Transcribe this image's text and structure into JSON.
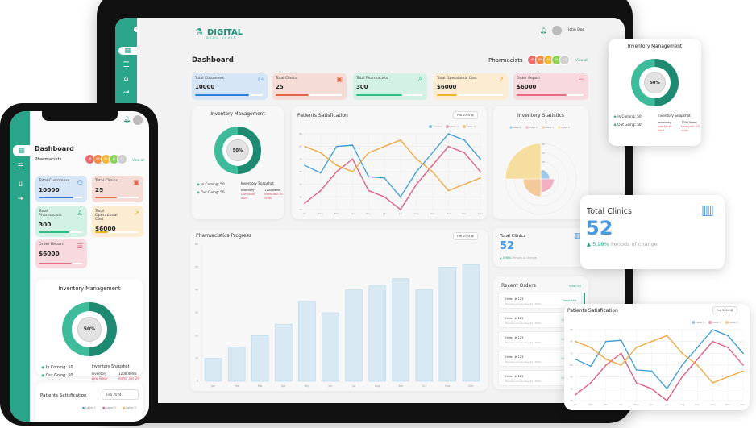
{
  "app": {
    "logo_main": "DIGITAL",
    "logo_sub": "DRUG VAULT",
    "user_name": "John Doe"
  },
  "colors": {
    "accent": "#2aa58a",
    "blue": "#3a9ad9",
    "pink": "#e0567f",
    "orange": "#f0a53a"
  },
  "dashboard": {
    "title": "Dashboard",
    "pharmacists_label": "Pharmacists",
    "pharmacist_avatars": [
      {
        "initials": "JD",
        "color": "#ea6b6b"
      },
      {
        "initials": "AM",
        "color": "#f08a4b"
      },
      {
        "initials": "AK",
        "color": "#f3b73b"
      },
      {
        "initials": "JA",
        "color": "#8bd35a"
      },
      {
        "initials": "+2",
        "color": "#cfcfcf"
      }
    ],
    "view_all": "View all",
    "stats": [
      {
        "label": "Total Customers",
        "value": "10000",
        "icon": "users-icon",
        "glyph": "⚇",
        "bg": "#d6e6f7",
        "color": "#2f7fd8",
        "progress": 0.8
      },
      {
        "label": "Total Clinics",
        "value": "25",
        "icon": "clinic-icon",
        "glyph": "▣",
        "bg": "#f6dcd6",
        "color": "#e0674a",
        "progress": 0.5
      },
      {
        "label": "Total Pharmacists",
        "value": "300",
        "icon": "user-icon",
        "glyph": "♙",
        "bg": "#d4f1e6",
        "color": "#2dbd85",
        "progress": 0.7
      },
      {
        "label": "Total Operational Cost",
        "value": "$6000",
        "icon": "trend-chart-icon",
        "glyph": "↗",
        "bg": "#fbecd2",
        "color": "#f0b429",
        "progress": 0.3
      },
      {
        "label": "Order Report",
        "value": "$6000",
        "icon": "list-icon",
        "glyph": "☰",
        "bg": "#f8d9df",
        "color": "#e86a83",
        "progress": 0.75
      }
    ]
  },
  "inventory": {
    "title": "Inventory Management",
    "percent": "50%",
    "incoming": "In Coming: 50",
    "outgoing": "Out Going: 50",
    "snapshot_title": "Inventory Snapshot",
    "snapshot_rows": [
      [
        "Inventory",
        "1200 Items"
      ],
      [
        "Low Stock Alert",
        "Items abc 20 units"
      ]
    ]
  },
  "date_filter": {
    "label": "Date",
    "value": "Feb 2024"
  },
  "patients_title": "Patients Satisfication",
  "progress_title": "Pharmacistics Progress",
  "inventory_stats_title": "Inventory Statistics",
  "total_clinics": {
    "title": "Total Clinics",
    "value": "52",
    "change": "5.98%",
    "change_label": "Periods of change"
  },
  "recent_orders": {
    "title": "Recent Orders",
    "view_all": "View all",
    "items": [
      {
        "order": "Order # 123",
        "delivery": "Delivery on January 21, 2024",
        "status": "Completed"
      },
      {
        "order": "Order # 123",
        "delivery": "Delivery on January 21, 2024",
        "status": "Completed"
      },
      {
        "order": "Order # 123",
        "delivery": "Delivery on January 21, 2024",
        "status": "Completed"
      },
      {
        "order": "Order # 123",
        "delivery": "Delivery on January 21, 2024",
        "status": "Completed"
      },
      {
        "order": "Order # 123",
        "delivery": "Delivery on January 21, 2024",
        "status": "Completed"
      }
    ]
  },
  "chart_data": [
    {
      "type": "line",
      "title": "Patients Satisfication",
      "categories": [
        "Jan",
        "Feb",
        "Mar",
        "Apr",
        "May",
        "Jun",
        "Jul",
        "Aug",
        "Sep",
        "Oct",
        "Nov",
        "Dec"
      ],
      "ylim": [
        30,
        90
      ],
      "yticks": [
        30,
        40,
        50,
        60,
        70,
        80,
        90
      ],
      "grid": true,
      "legend": "top-right",
      "series": [
        {
          "name": "Label 1",
          "color": "#3a9ad9",
          "values": [
            65,
            59,
            80,
            81,
            56,
            55,
            40,
            60,
            75,
            90,
            85,
            70
          ]
        },
        {
          "name": "Label 2",
          "color": "#e0567f",
          "values": [
            35,
            45,
            60,
            70,
            45,
            40,
            30,
            50,
            65,
            80,
            75,
            60
          ]
        },
        {
          "name": "Label 3",
          "color": "#f0a53a",
          "values": [
            80,
            75,
            65,
            60,
            75,
            80,
            85,
            70,
            60,
            45,
            50,
            55
          ]
        }
      ]
    },
    {
      "type": "bar",
      "title": "Pharmacistics Progress",
      "categories": [
        "Jan",
        "Feb",
        "Mar",
        "Apr",
        "May",
        "Jun",
        "Jul",
        "Aug",
        "Sep",
        "Oct",
        "Nov",
        "Dec"
      ],
      "values": [
        10,
        15,
        20,
        25,
        35,
        30,
        40,
        42,
        45,
        40,
        50,
        51
      ],
      "ylim": [
        0,
        60
      ],
      "yticks": [
        0,
        10,
        20,
        30,
        40,
        50,
        60
      ],
      "color": "#d8e9f3"
    },
    {
      "type": "polar-area",
      "title": "Inventory Statistics",
      "legend": "top",
      "categories": [
        "Label 1",
        "Label 2",
        "Label 3",
        "Label 4"
      ],
      "values": [
        10,
        15,
        20,
        40
      ],
      "colors": [
        "#9cc9ea",
        "#f2b1c3",
        "#f3c99a",
        "#f5dea0"
      ],
      "rticks": [
        10,
        20,
        30,
        40
      ]
    },
    {
      "type": "pie",
      "title": "Inventory Management",
      "categories": [
        "In Coming",
        "Out Going"
      ],
      "values": [
        50,
        50
      ],
      "colors": [
        "#3dbb9a",
        "#1e8a72"
      ]
    }
  ]
}
